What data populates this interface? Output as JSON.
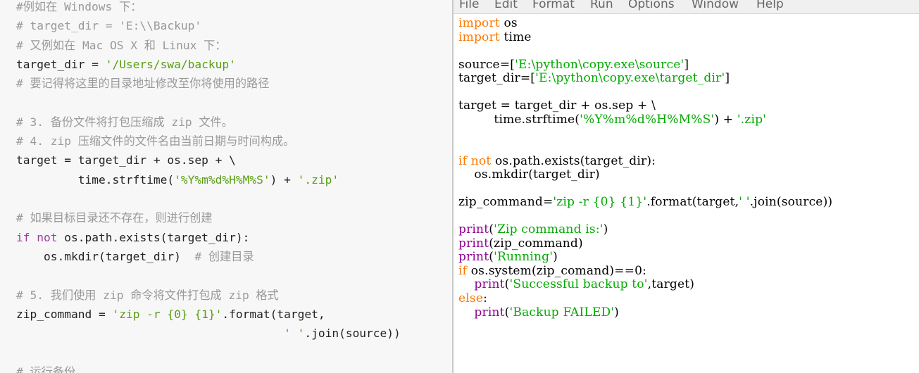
{
  "tutorial": {
    "lines": [
      [
        {
          "t": "c",
          "v": "#例如在 Windows 下："
        }
      ],
      [
        {
          "t": "c",
          "v": "# target_dir = 'E:\\\\Backup'"
        }
      ],
      [
        {
          "t": "c",
          "v": "# 又例如在 Mac OS X 和 Linux 下："
        }
      ],
      [
        {
          "t": "o",
          "v": "target_dir = "
        },
        {
          "t": "s",
          "v": "'/Users/swa/backup'"
        }
      ],
      [
        {
          "t": "c",
          "v": "# 要记得将这里的目录地址修改至你将使用的路径"
        }
      ],
      [],
      [
        {
          "t": "c",
          "v": "# 3. 备份文件将打包压缩成 zip 文件。"
        }
      ],
      [
        {
          "t": "c",
          "v": "# 4. zip 压缩文件的文件名由当前日期与时间构成。"
        }
      ],
      [
        {
          "t": "o",
          "v": "target = target_dir + os.sep + \\"
        }
      ],
      [
        {
          "t": "o",
          "v": "         time.strftime("
        },
        {
          "t": "s",
          "v": "'%Y%m%d%H%M%S'"
        },
        {
          "t": "o",
          "v": ") + "
        },
        {
          "t": "s",
          "v": "'.zip'"
        }
      ],
      [],
      [
        {
          "t": "c",
          "v": "# 如果目标目录还不存在，则进行创建"
        }
      ],
      [
        {
          "t": "k",
          "v": "if"
        },
        {
          "t": "o",
          "v": " "
        },
        {
          "t": "k",
          "v": "not"
        },
        {
          "t": "o",
          "v": " os.path.exists(target_dir):"
        }
      ],
      [
        {
          "t": "o",
          "v": "    os.mkdir(target_dir)  "
        },
        {
          "t": "c",
          "v": "# 创建目录"
        }
      ],
      [],
      [
        {
          "t": "c",
          "v": "# 5. 我们使用 zip 命令将文件打包成 zip 格式"
        }
      ],
      [
        {
          "t": "o",
          "v": "zip_command = "
        },
        {
          "t": "s",
          "v": "'zip -r {0} {1}'"
        },
        {
          "t": "o",
          "v": ".format(target,"
        }
      ],
      [
        {
          "t": "o",
          "v": "                                       "
        },
        {
          "t": "s",
          "v": "' '"
        },
        {
          "t": "o",
          "v": ".join(source))"
        }
      ],
      [],
      [
        {
          "t": "c",
          "v": "# 运行备份"
        }
      ]
    ]
  },
  "idle": {
    "menu": [
      "File",
      "Edit",
      "Format",
      "Run",
      "Options",
      "Window",
      "Help"
    ],
    "lines": [
      [
        {
          "t": "k",
          "v": "import"
        },
        {
          "t": "o",
          "v": " os"
        }
      ],
      [
        {
          "t": "k",
          "v": "import"
        },
        {
          "t": "o",
          "v": " time"
        }
      ],
      [],
      [
        {
          "t": "o",
          "v": "source=["
        },
        {
          "t": "s",
          "v": "'E:\\python\\copy.exe\\source'"
        },
        {
          "t": "o",
          "v": "]"
        }
      ],
      [
        {
          "t": "o",
          "v": "target_dir=["
        },
        {
          "t": "s",
          "v": "'E:\\python\\copy.exe\\target_dir'"
        },
        {
          "t": "o",
          "v": "]"
        }
      ],
      [],
      [
        {
          "t": "o",
          "v": "target = target_dir + os.sep + \\"
        }
      ],
      [
        {
          "t": "o",
          "v": "         time.strftime("
        },
        {
          "t": "s",
          "v": "'%Y%m%d%H%M%S'"
        },
        {
          "t": "o",
          "v": ") + "
        },
        {
          "t": "s",
          "v": "'.zip'"
        }
      ],
      [],
      [],
      [
        {
          "t": "k",
          "v": "if"
        },
        {
          "t": "o",
          "v": " "
        },
        {
          "t": "k",
          "v": "not"
        },
        {
          "t": "o",
          "v": " os.path.exists(target_dir):"
        }
      ],
      [
        {
          "t": "o",
          "v": "    os.mkdir(target_dir)"
        }
      ],
      [],
      [
        {
          "t": "o",
          "v": "zip_command="
        },
        {
          "t": "s",
          "v": "'zip -r {0} {1}'"
        },
        {
          "t": "o",
          "v": ".format(target,"
        },
        {
          "t": "s",
          "v": "' '"
        },
        {
          "t": "o",
          "v": ".join(source))"
        }
      ],
      [],
      [
        {
          "t": "b",
          "v": "print"
        },
        {
          "t": "o",
          "v": "("
        },
        {
          "t": "s",
          "v": "'Zip command is:'"
        },
        {
          "t": "o",
          "v": ")"
        }
      ],
      [
        {
          "t": "b",
          "v": "print"
        },
        {
          "t": "o",
          "v": "(zip_command)"
        }
      ],
      [
        {
          "t": "b",
          "v": "print"
        },
        {
          "t": "o",
          "v": "("
        },
        {
          "t": "s",
          "v": "'Running'"
        },
        {
          "t": "o",
          "v": ")"
        }
      ],
      [
        {
          "t": "k",
          "v": "if"
        },
        {
          "t": "o",
          "v": " os.system(zip_comand)==0:"
        }
      ],
      [
        {
          "t": "o",
          "v": "    "
        },
        {
          "t": "b",
          "v": "print"
        },
        {
          "t": "o",
          "v": "("
        },
        {
          "t": "s",
          "v": "'Successful backup to'"
        },
        {
          "t": "o",
          "v": ",target)"
        }
      ],
      [
        {
          "t": "k",
          "v": "else"
        },
        {
          "t": "o",
          "v": ":"
        }
      ],
      [
        {
          "t": "o",
          "v": "    "
        },
        {
          "t": "b",
          "v": "print"
        },
        {
          "t": "o",
          "v": "("
        },
        {
          "t": "s",
          "v": "'Backup FAILED'"
        },
        {
          "t": "o",
          "v": ")"
        }
      ]
    ]
  },
  "colors": {
    "tutorial_comment": "#999999",
    "tutorial_string": "#5a9e12",
    "tutorial_keyword": "#9b3d9b",
    "idle_keyword": "#ff7700",
    "idle_builtin": "#900090",
    "idle_string": "#00aa00"
  }
}
